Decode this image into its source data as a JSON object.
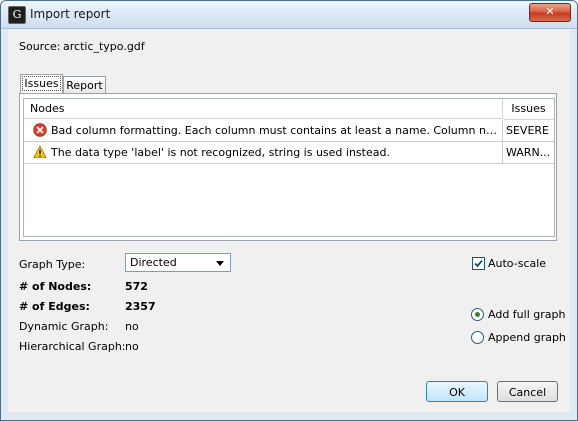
{
  "window": {
    "title": "Import report",
    "close_label": "✕"
  },
  "source": {
    "label": "Source:",
    "value": "arctic_typo.gdf"
  },
  "tabs": [
    {
      "label": "Issues"
    },
    {
      "label": "Report"
    }
  ],
  "table": {
    "columns": [
      "Nodes",
      "Issues"
    ],
    "rows": [
      {
        "message": "Bad column formatting. Each column must contains at least a name. Column names must no...",
        "level": "SEVERE",
        "icon": "error-icon"
      },
      {
        "message": "The data type 'label' is not recognized, string is used instead.",
        "level": "WARN...",
        "icon": "warning-icon"
      }
    ]
  },
  "settings": {
    "graph_type_label": "Graph Type:",
    "graph_type_value": "Directed",
    "nodes_label": "# of Nodes:",
    "nodes_value": "572",
    "edges_label": "# of Edges:",
    "edges_value": "2357",
    "dynamic_label": "Dynamic Graph:",
    "dynamic_value": "no",
    "hierarchical_label": "Hierarchical Graph:",
    "hierarchical_value": "no"
  },
  "options": {
    "autoscale_label": "Auto-scale",
    "autoscale_checked": true,
    "add_full_graph_label": "Add full graph",
    "append_graph_label": "Append graph",
    "selected": "Add full graph"
  },
  "buttons": {
    "ok": "OK",
    "cancel": "Cancel"
  }
}
